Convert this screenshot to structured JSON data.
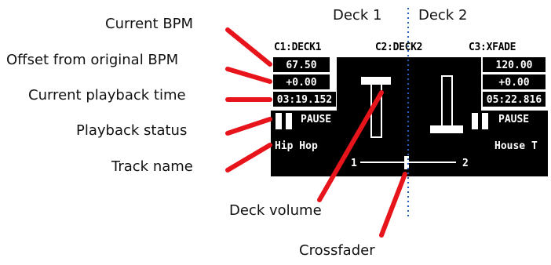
{
  "callouts": {
    "current_bpm": "Current BPM",
    "offset": "Offset from original BPM",
    "playback_time": "Current playback time",
    "playback_status": "Playback status",
    "track_name": "Track name",
    "deck_volume": "Deck volume",
    "crossfader": "Crossfader"
  },
  "decks": {
    "deck1_title": "Deck 1",
    "deck2_title": "Deck 2"
  },
  "screen": {
    "col1_label": "C1:DECK1",
    "col2_label": "C2:DECK2",
    "col3_label": "C3:XFADE",
    "deck1": {
      "bpm": "67.50",
      "offset": "+0.00",
      "time": "03:19.152",
      "status": "PAUSE",
      "track": "Hip Hop"
    },
    "deck2": {
      "bpm": "120.00",
      "offset": "+0.00",
      "time": "05:22.816",
      "status": "PAUSE",
      "track": "House T"
    },
    "xfader_left": "1",
    "xfader_right": "2"
  },
  "colors": {
    "callout_line": "#e8141b",
    "divider": "#1f5fbf",
    "screen_bg": "#000000",
    "screen_fg": "#ffffff"
  }
}
